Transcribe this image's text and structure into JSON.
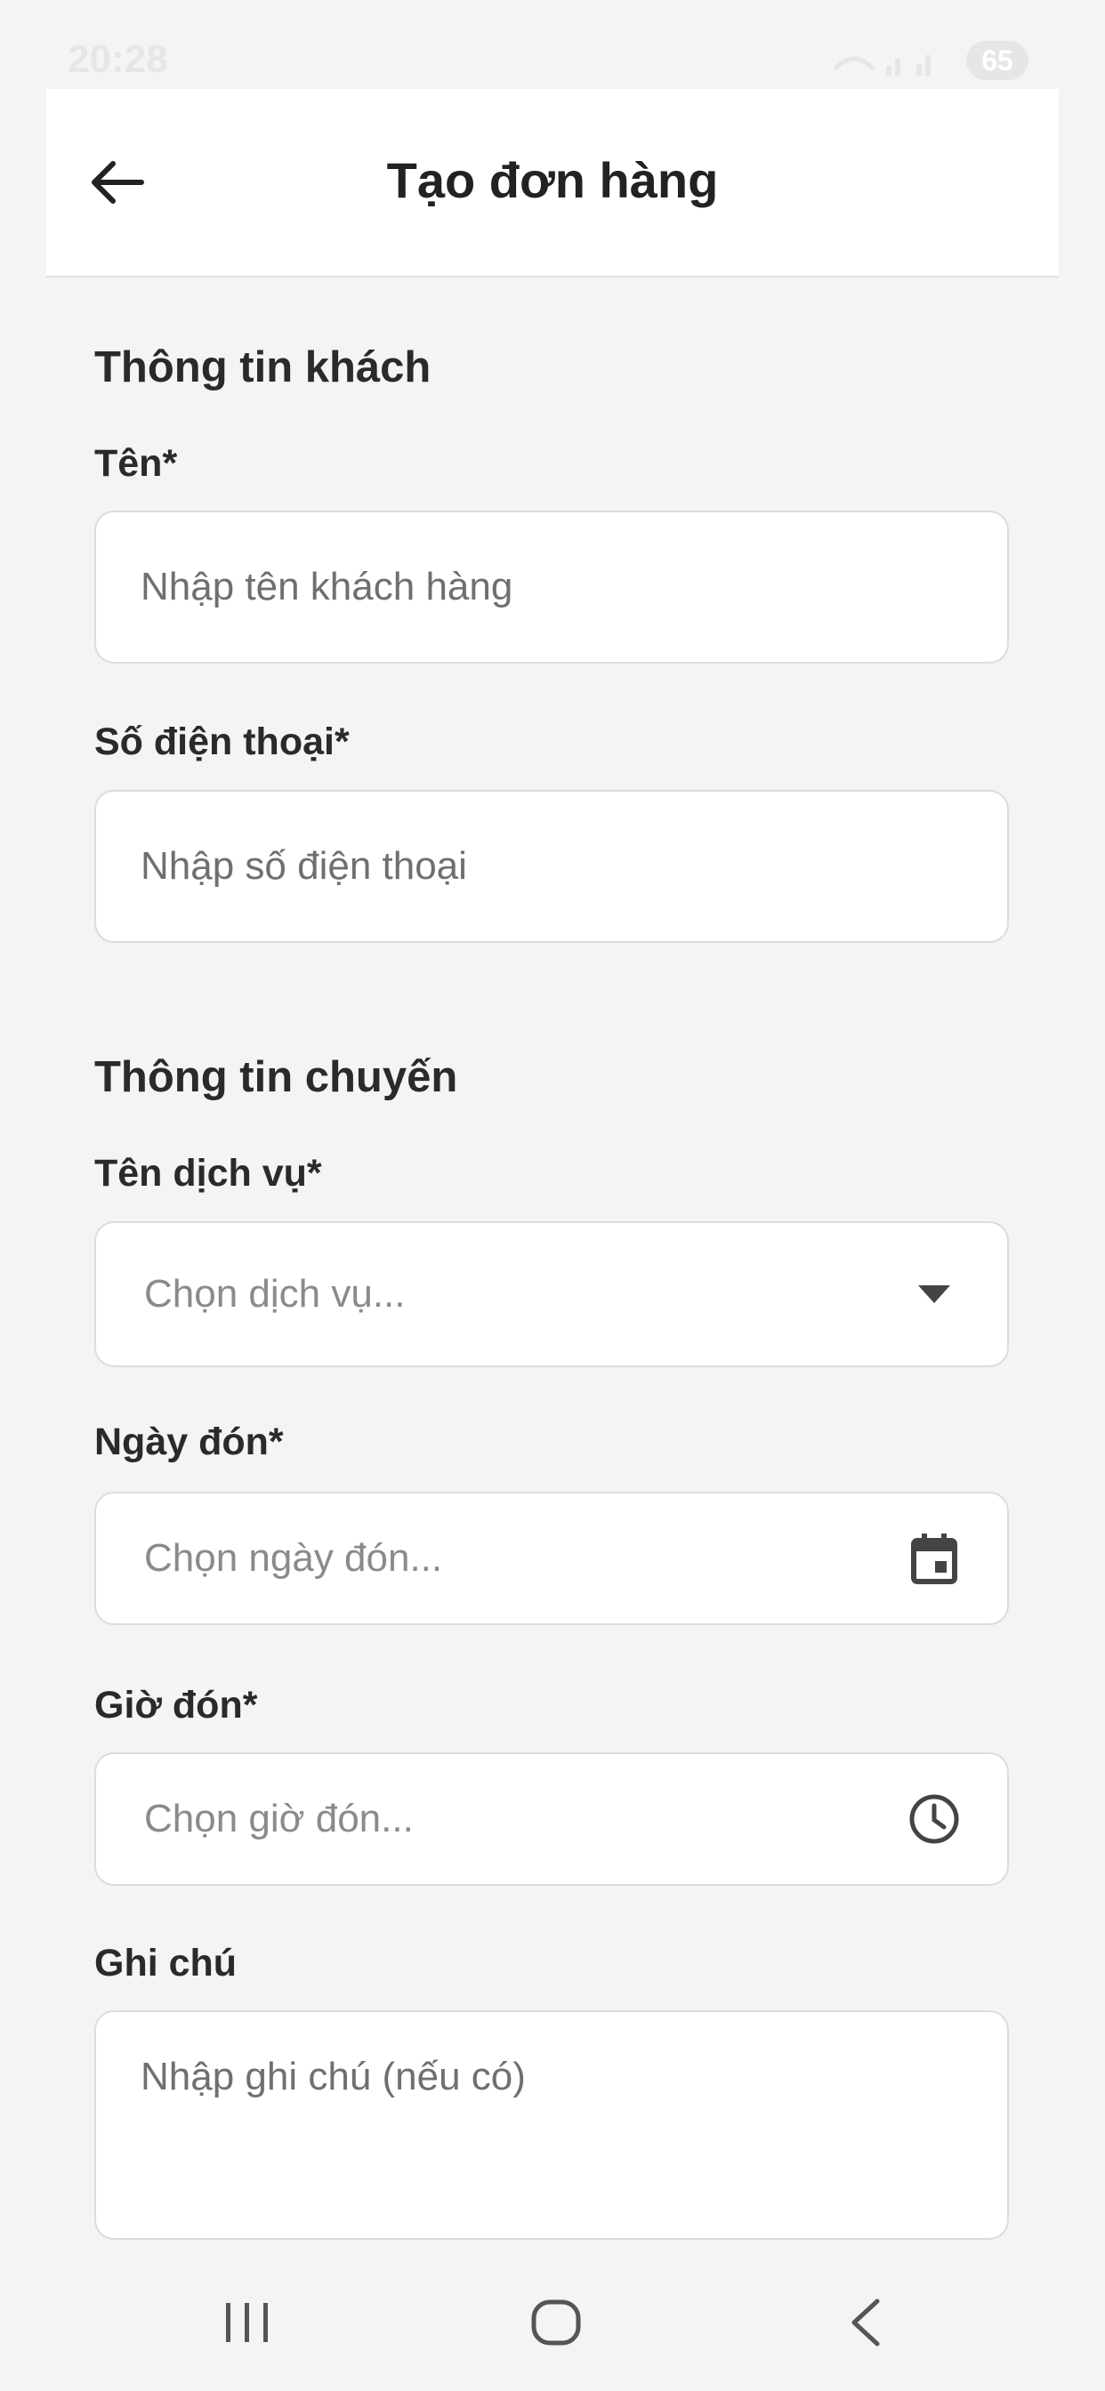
{
  "status_bar": {
    "time": "20:28",
    "battery": "65"
  },
  "header": {
    "title": "Tạo đơn hàng",
    "back_icon": "arrow-left-icon"
  },
  "customer_section": {
    "title": "Thông tin khách",
    "name_label": "Tên*",
    "name_placeholder": "Nhập tên khách hàng",
    "phone_label": "Số điện thoại*",
    "phone_placeholder": "Nhập số điện thoại"
  },
  "trip_section": {
    "title": "Thông tin chuyến",
    "service_label": "Tên dịch vụ*",
    "service_placeholder": "Chọn dịch vụ...",
    "service_icon": "caret-down-icon",
    "date_label": "Ngày đón*",
    "date_placeholder": "Chọn ngày đón...",
    "date_icon": "calendar-icon",
    "time_label": "Giờ đón*",
    "time_placeholder": "Chọn giờ đón...",
    "time_icon": "clock-icon",
    "note_label": "Ghi chú",
    "note_placeholder": "Nhập ghi chú (nếu có)"
  },
  "nav_bar": {
    "recents_icon": "recent-apps-icon",
    "home_icon": "home-icon",
    "back_icon": "back-chevron-icon"
  },
  "colors": {
    "background": "#f4f4f4",
    "surface": "#ffffff",
    "text": "#222222",
    "placeholder": "#8a8a8a",
    "border": "#dcdcdc"
  }
}
